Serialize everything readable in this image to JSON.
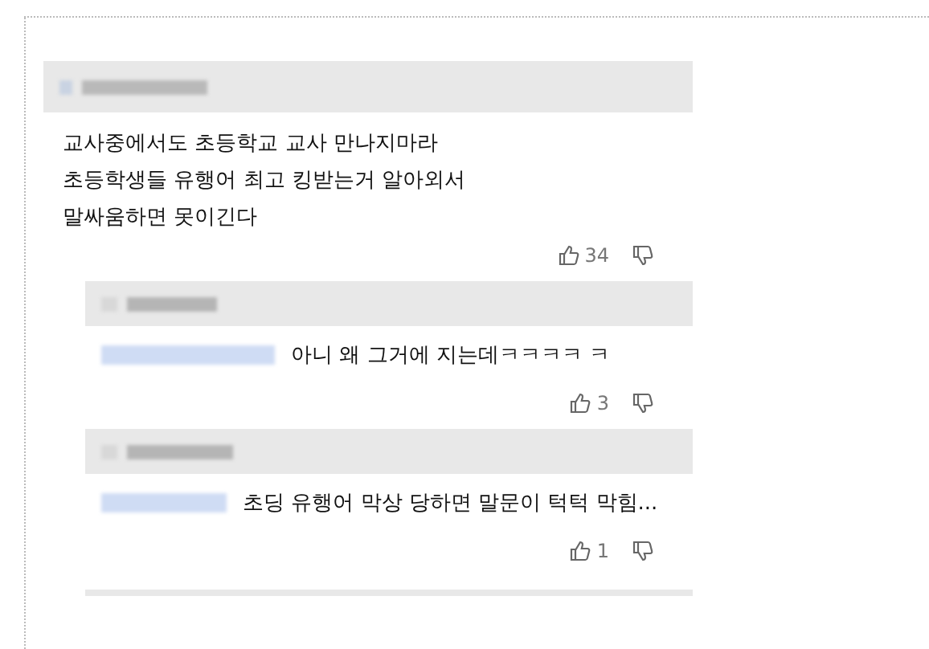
{
  "comments": [
    {
      "text": "교사중에서도 초등학교 교사 만나지마라\n초등학생들 유행어 최고 킹받는거 알아외서\n말싸움하면 못이긴다",
      "likes": "34",
      "replies": [
        {
          "text": "아니 왜 그거에 지는데ㅋㅋㅋㅋ ㅋ",
          "likes": "3"
        },
        {
          "text": "초딩 유행어 막상 당하면 말문이 턱턱 막힘...",
          "likes": "1"
        }
      ]
    }
  ]
}
